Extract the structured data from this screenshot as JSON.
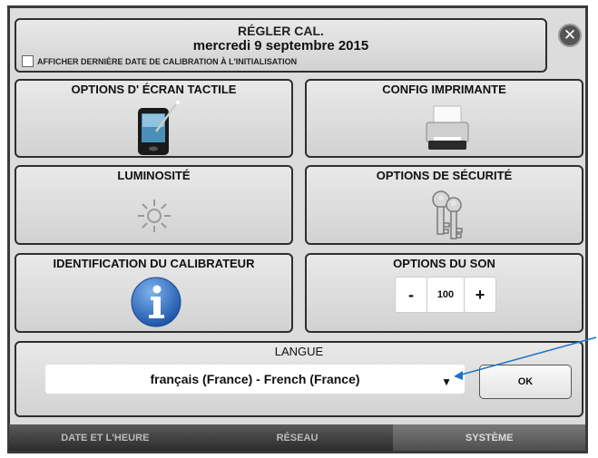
{
  "header": {
    "title": "RÉGLER CAL.",
    "date": "mercredi 9 septembre 2015",
    "checkbox_label": "AFFICHER DERNIÈRE DATE DE CALIBRATION À L'INITIALISATION",
    "checkbox_checked": false,
    "close_glyph": "✕"
  },
  "tiles": {
    "touch_screen": {
      "label": "OPTIONS D' ÉCRAN TACTILE",
      "icon": "touchscreen-phone-icon"
    },
    "printer": {
      "label": "CONFIG IMPRIMANTE",
      "icon": "printer-icon"
    },
    "brightness": {
      "label": "LUMINOSITÉ",
      "icon": "brightness-sun-icon"
    },
    "security": {
      "label": "OPTIONS DE SÉCURITÉ",
      "icon": "keys-icon"
    },
    "identification": {
      "label": "IDENTIFICATION DU CALIBRATEUR",
      "icon": "info-icon"
    },
    "sound": {
      "label": "OPTIONS DU SON",
      "minus": "-",
      "value": "100",
      "plus": "+"
    }
  },
  "language": {
    "label": "LANGUE",
    "selected": "français (France) - French (France)",
    "arrow": "▼",
    "ok_label": "OK"
  },
  "tabs": [
    {
      "label": "DATE ET L'HEURE",
      "active": false
    },
    {
      "label": "RÉSEAU",
      "active": false
    },
    {
      "label": "SYSTÈME",
      "active": true
    }
  ],
  "colors": {
    "panel_border": "#2e2e2e",
    "info_blue": "#2f6fc4",
    "annotation_line": "#1e73c8"
  }
}
